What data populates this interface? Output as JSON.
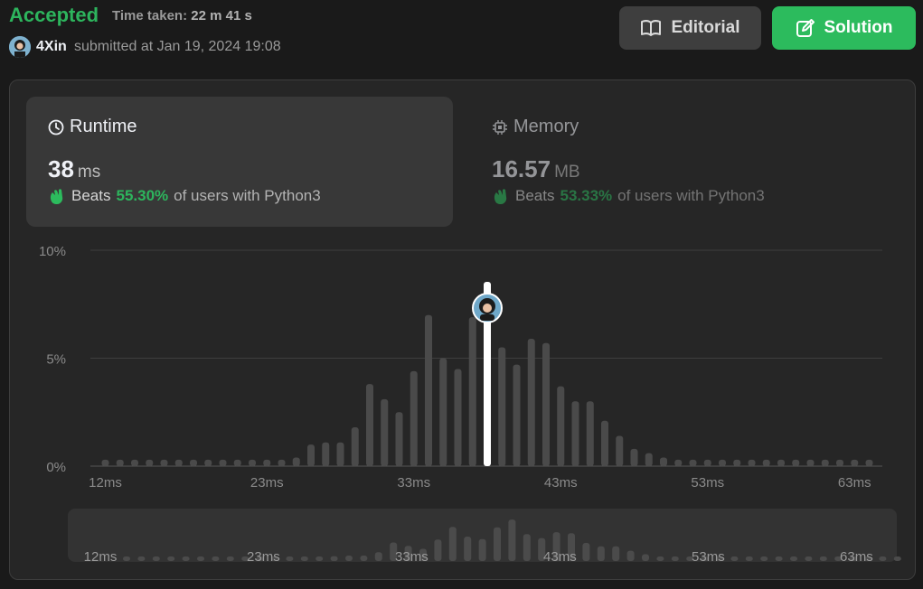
{
  "header": {
    "status": "Accepted",
    "time_taken_label": "Time taken:",
    "time_taken_value": "22 m 41 s",
    "username": "4Xin",
    "submitted": "submitted at Jan 19, 2024 19:08",
    "editorial_label": "Editorial",
    "solution_label": "Solution"
  },
  "runtime": {
    "title": "Runtime",
    "value": "38",
    "unit": "ms",
    "beats_prefix": "Beats",
    "beats_pct": "55.30%",
    "beats_suffix": "of users with Python3"
  },
  "memory": {
    "title": "Memory",
    "value": "16.57",
    "unit": "MB",
    "beats_prefix": "Beats",
    "beats_pct": "53.33%",
    "beats_suffix": "of users with Python3"
  },
  "colors": {
    "accent_green": "#2cbb5d",
    "bar": "#4a4a4a",
    "highlight_bar": "#ffffff"
  },
  "chart_data": {
    "type": "bar",
    "x_unit": "ms",
    "xmin": 12,
    "xmax": 64,
    "tick_labels": [
      "12ms",
      "23ms",
      "33ms",
      "43ms",
      "53ms",
      "63ms"
    ],
    "y_tick_labels": [
      "10%",
      "5%",
      "0%"
    ],
    "ylim": [
      0,
      10
    ],
    "highlight": 38,
    "values": [
      0.3,
      0.3,
      0.3,
      0.3,
      0.3,
      0.3,
      0.3,
      0.3,
      0.3,
      0.3,
      0.3,
      0.3,
      0.3,
      0.4,
      1.0,
      1.1,
      1.1,
      1.8,
      3.8,
      3.1,
      2.5,
      4.4,
      7.0,
      5.0,
      4.5,
      6.9,
      8.5,
      5.5,
      4.7,
      5.9,
      5.7,
      3.7,
      3.0,
      3.0,
      2.1,
      1.4,
      0.8,
      0.6,
      0.4,
      0.3,
      0.3,
      0.3,
      0.3,
      0.3,
      0.3,
      0.3,
      0.3,
      0.3,
      0.3,
      0.3,
      0.3,
      0.3,
      0.3
    ]
  }
}
